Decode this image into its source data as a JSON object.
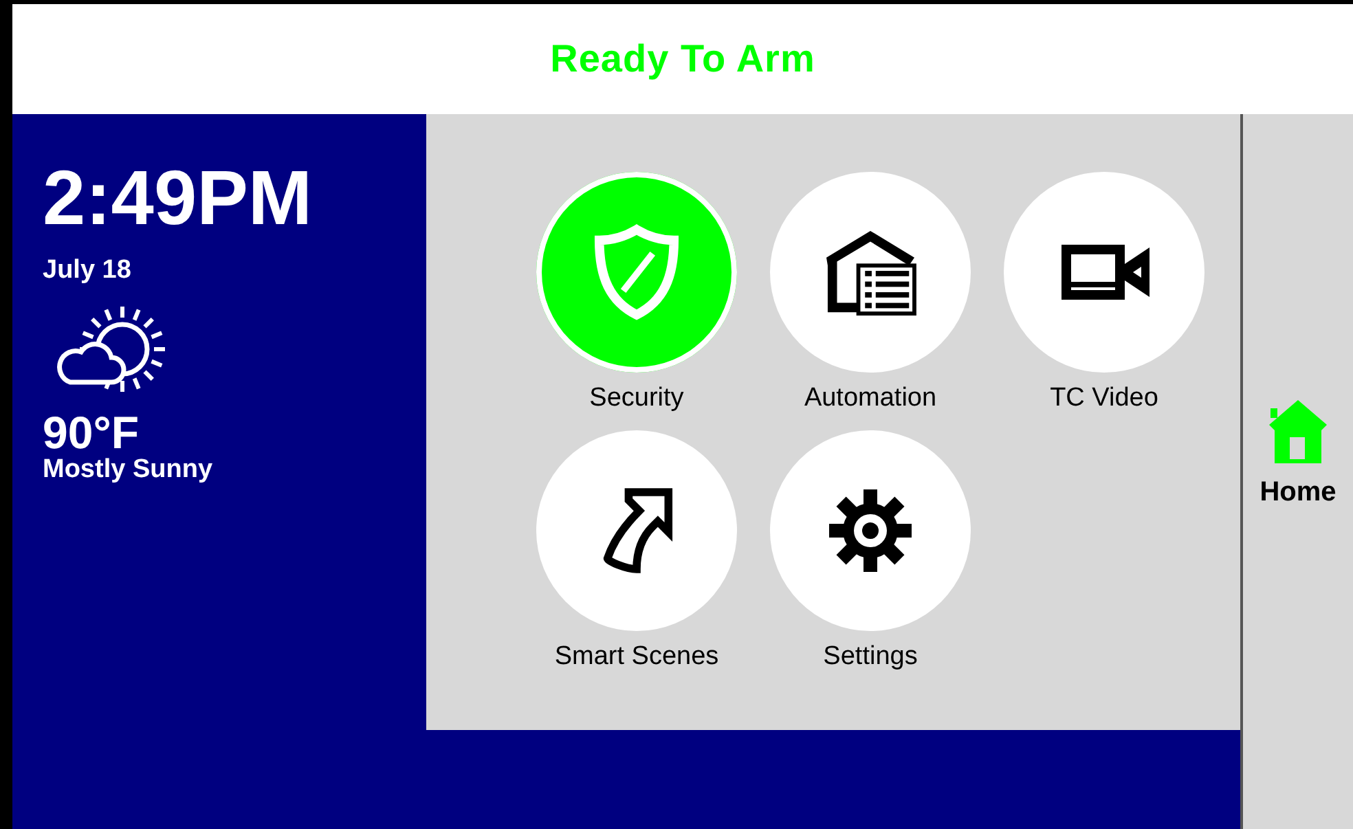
{
  "header": {
    "status": "Ready To Arm"
  },
  "info": {
    "time": "2:49PM",
    "date": "July 18",
    "temperature": "90°F",
    "condition": "Mostly Sunny"
  },
  "tiles": [
    {
      "label": "Security",
      "kind": "security",
      "selected": true
    },
    {
      "label": "Automation",
      "kind": "automation",
      "selected": false
    },
    {
      "label": "TC Video",
      "kind": "video",
      "selected": false
    },
    {
      "label": "Smart Scenes",
      "kind": "scenes",
      "selected": false
    },
    {
      "label": "Settings",
      "kind": "settings",
      "selected": false
    }
  ],
  "nav": [
    {
      "label": "Home",
      "selected": true
    }
  ]
}
